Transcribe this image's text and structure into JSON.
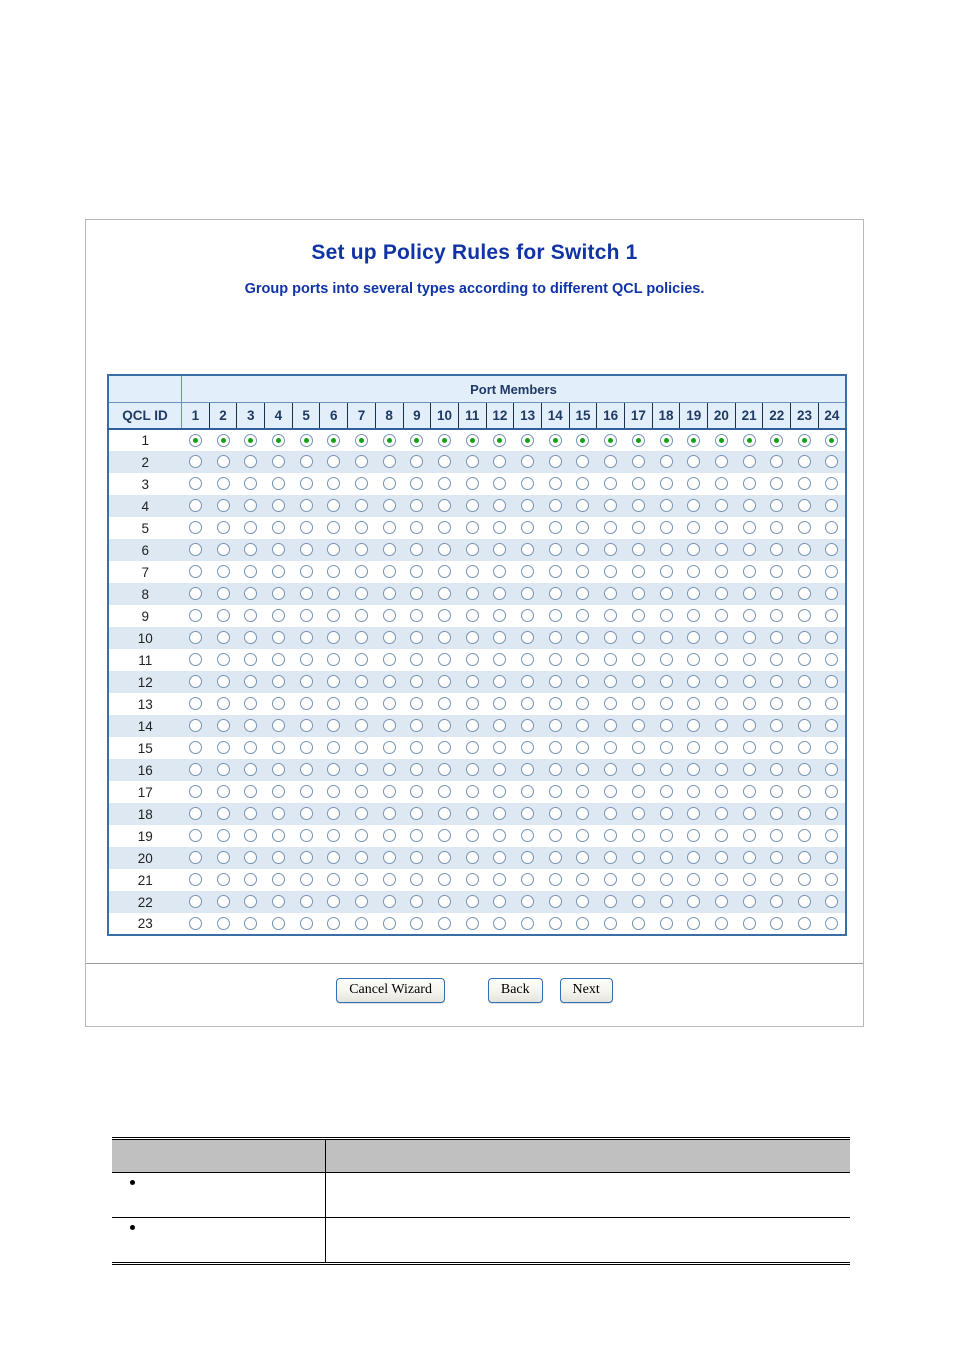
{
  "panel": {
    "title": "Set up Policy Rules for Switch 1",
    "subtitle": "Group ports into several types according to different QCL policies."
  },
  "matrix": {
    "group_header": "Port Members",
    "rowid_header": "QCL ID",
    "ports": [
      "1",
      "2",
      "3",
      "4",
      "5",
      "6",
      "7",
      "8",
      "9",
      "10",
      "11",
      "12",
      "13",
      "14",
      "15",
      "16",
      "17",
      "18",
      "19",
      "20",
      "21",
      "22",
      "23",
      "24"
    ],
    "rows": [
      {
        "id": "1",
        "selected_ports": [
          "1",
          "2",
          "3",
          "4",
          "5",
          "6",
          "7",
          "8",
          "9",
          "10",
          "11",
          "12",
          "13",
          "14",
          "15",
          "16",
          "17",
          "18",
          "19",
          "20",
          "21",
          "22",
          "23",
          "24"
        ]
      },
      {
        "id": "2",
        "selected_ports": []
      },
      {
        "id": "3",
        "selected_ports": []
      },
      {
        "id": "4",
        "selected_ports": []
      },
      {
        "id": "5",
        "selected_ports": []
      },
      {
        "id": "6",
        "selected_ports": []
      },
      {
        "id": "7",
        "selected_ports": []
      },
      {
        "id": "8",
        "selected_ports": []
      },
      {
        "id": "9",
        "selected_ports": []
      },
      {
        "id": "10",
        "selected_ports": []
      },
      {
        "id": "11",
        "selected_ports": []
      },
      {
        "id": "12",
        "selected_ports": []
      },
      {
        "id": "13",
        "selected_ports": []
      },
      {
        "id": "14",
        "selected_ports": []
      },
      {
        "id": "15",
        "selected_ports": []
      },
      {
        "id": "16",
        "selected_ports": []
      },
      {
        "id": "17",
        "selected_ports": []
      },
      {
        "id": "18",
        "selected_ports": []
      },
      {
        "id": "19",
        "selected_ports": []
      },
      {
        "id": "20",
        "selected_ports": []
      },
      {
        "id": "21",
        "selected_ports": []
      },
      {
        "id": "22",
        "selected_ports": []
      },
      {
        "id": "23",
        "selected_ports": []
      }
    ]
  },
  "footer": {
    "cancel_label": "Cancel Wizard",
    "back_label": "Back",
    "next_label": "Next"
  },
  "description_table": {
    "headers": [
      "",
      ""
    ],
    "rows": [
      {
        "term": "",
        "description": ""
      },
      {
        "term": "",
        "description": ""
      }
    ]
  },
  "colors": {
    "title_blue": "#1034a6",
    "table_border_blue": "#3a6ea5",
    "header_fill": "#e3eefb",
    "row_alt_fill": "#dde8f3",
    "radio_on_green": "#14a014",
    "desc_header_gray": "#c0c0c0"
  }
}
